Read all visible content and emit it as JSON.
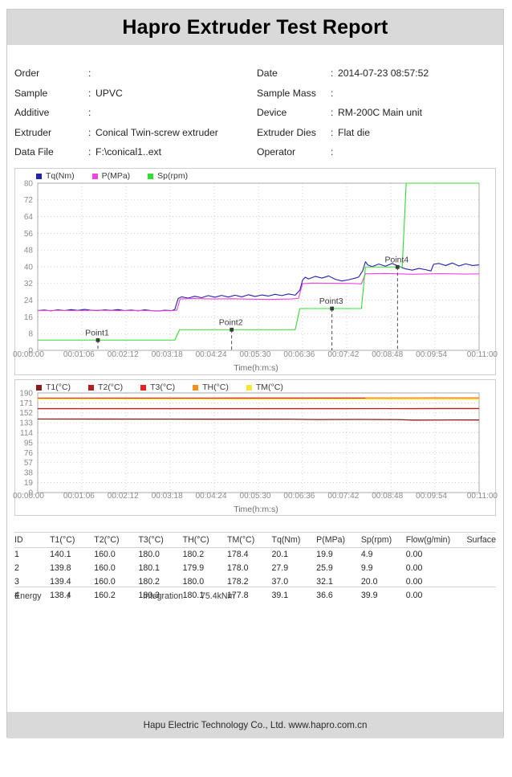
{
  "report": {
    "title": "Hapro Extruder Test Report",
    "footer": "Hapu Electric Technology Co., Ltd. www.hapro.com.cn"
  },
  "meta": {
    "colon": ":",
    "rows": [
      {
        "left_label": "Order",
        "left_value": "",
        "right_label": "Date",
        "right_value": "2014-07-23  08:57:52"
      },
      {
        "left_label": "Sample",
        "left_value": "UPVC",
        "right_label": "Sample Mass",
        "right_value": ""
      },
      {
        "left_label": "Additive",
        "left_value": "",
        "right_label": "Device",
        "right_value": "RM-200C Main unit"
      },
      {
        "left_label": "Extruder",
        "left_value": "Conical Twin-screw extruder",
        "right_label": "Extruder Dies",
        "right_value": "Flat die"
      },
      {
        "left_label": "Data File",
        "left_value": "F:\\conical1..ext",
        "right_label": "Operator",
        "right_value": ""
      }
    ]
  },
  "chart_data": [
    {
      "id": "torque-pressure-speed",
      "type": "line",
      "title": "",
      "xlabel": "Time(h:m:s)",
      "ylabel": "",
      "ylim": [
        0,
        80
      ],
      "yticks": [
        0,
        8,
        16,
        24,
        32,
        40,
        48,
        56,
        64,
        72,
        80
      ],
      "xlim": [
        0,
        660
      ],
      "xticks": [
        "00:00:00",
        "00:01:06",
        "00:02:12",
        "00:03:18",
        "00:04:24",
        "00:05:30",
        "00:06:36",
        "00:07:42",
        "00:08:48",
        "00:09:54",
        "00:11:00"
      ],
      "grid": true,
      "legend_position": "top-left",
      "series": [
        {
          "name": "Tq(Nm)",
          "color": "#2222aa",
          "points": [
            [
              0,
              19.0
            ],
            [
              10,
              19.3
            ],
            [
              20,
              18.9
            ],
            [
              30,
              19.4
            ],
            [
              40,
              19.0
            ],
            [
              50,
              19.5
            ],
            [
              60,
              19.1
            ],
            [
              70,
              19.6
            ],
            [
              80,
              19.2
            ],
            [
              90,
              19.0
            ],
            [
              100,
              19.4
            ],
            [
              110,
              19.1
            ],
            [
              120,
              19.5
            ],
            [
              130,
              19.0
            ],
            [
              140,
              19.3
            ],
            [
              150,
              18.9
            ],
            [
              160,
              19.4
            ],
            [
              170,
              19.0
            ],
            [
              180,
              18.8
            ],
            [
              190,
              19.2
            ],
            [
              200,
              19.0
            ],
            [
              205,
              19.6
            ],
            [
              210,
              24.8
            ],
            [
              215,
              25.6
            ],
            [
              225,
              25.0
            ],
            [
              235,
              25.9
            ],
            [
              245,
              25.2
            ],
            [
              255,
              26.2
            ],
            [
              265,
              25.4
            ],
            [
              275,
              26.3
            ],
            [
              285,
              25.5
            ],
            [
              295,
              26.4
            ],
            [
              305,
              25.6
            ],
            [
              315,
              26.6
            ],
            [
              325,
              25.8
            ],
            [
              335,
              26.5
            ],
            [
              345,
              26.0
            ],
            [
              355,
              26.8
            ],
            [
              365,
              26.2
            ],
            [
              375,
              27.0
            ],
            [
              385,
              26.4
            ],
            [
              392,
              28.8
            ],
            [
              396,
              33.6
            ],
            [
              400,
              35.0
            ],
            [
              405,
              34.2
            ],
            [
              415,
              35.4
            ],
            [
              425,
              34.6
            ],
            [
              435,
              35.6
            ],
            [
              445,
              34.0
            ],
            [
              455,
              33.2
            ],
            [
              465,
              33.8
            ],
            [
              475,
              34.6
            ],
            [
              480,
              35.1
            ],
            [
              486,
              38.1
            ],
            [
              490,
              42.4
            ],
            [
              494,
              40.8
            ],
            [
              500,
              40.1
            ],
            [
              510,
              41.3
            ],
            [
              520,
              40.3
            ],
            [
              530,
              41.6
            ],
            [
              540,
              40.2
            ],
            [
              550,
              39.0
            ],
            [
              560,
              38.4
            ],
            [
              570,
              39.2
            ],
            [
              580,
              38.6
            ],
            [
              588,
              38.0
            ],
            [
              592,
              41.2
            ],
            [
              600,
              41.6
            ],
            [
              610,
              40.6
            ],
            [
              620,
              41.8
            ],
            [
              630,
              40.4
            ],
            [
              640,
              41.4
            ],
            [
              650,
              40.6
            ],
            [
              660,
              40.9
            ]
          ]
        },
        {
          "name": "P(MPa)",
          "color": "#ee44dd",
          "points": [
            [
              0,
              19.0
            ],
            [
              30,
              19.1
            ],
            [
              60,
              19.0
            ],
            [
              90,
              19.2
            ],
            [
              120,
              19.0
            ],
            [
              150,
              19.1
            ],
            [
              180,
              18.9
            ],
            [
              200,
              19.0
            ],
            [
              208,
              19.2
            ],
            [
              213,
              24.6
            ],
            [
              230,
              24.8
            ],
            [
              260,
              24.6
            ],
            [
              290,
              24.7
            ],
            [
              320,
              24.5
            ],
            [
              350,
              24.4
            ],
            [
              380,
              24.6
            ],
            [
              390,
              24.9
            ],
            [
              396,
              31.9
            ],
            [
              410,
              32.2
            ],
            [
              440,
              32.1
            ],
            [
              470,
              32.0
            ],
            [
              484,
              31.8
            ],
            [
              490,
              36.6
            ],
            [
              520,
              36.8
            ],
            [
              560,
              36.4
            ],
            [
              600,
              36.7
            ],
            [
              640,
              36.5
            ],
            [
              660,
              36.6
            ]
          ]
        },
        {
          "name": "Sp(rpm)",
          "color": "#2ee02e",
          "points": [
            [
              0,
              4.9
            ],
            [
              205,
              4.9
            ],
            [
              212,
              9.9
            ],
            [
              385,
              9.9
            ],
            [
              392,
              20.0
            ],
            [
              484,
              20.0
            ],
            [
              490,
              39.9
            ],
            [
              545,
              39.9
            ],
            [
              551,
              80.0
            ],
            [
              660,
              80.0
            ]
          ]
        }
      ],
      "annotations": [
        {
          "label": "Point1",
          "x": 90,
          "y": 4.9,
          "series": "Sp(rpm)"
        },
        {
          "label": "Point2",
          "x": 290,
          "y": 9.9,
          "series": "Sp(rpm)"
        },
        {
          "label": "Point3",
          "x": 440,
          "y": 20.0,
          "series": "Sp(rpm)"
        },
        {
          "label": "Point4",
          "x": 538,
          "y": 39.9,
          "series": "Sp(rpm)"
        }
      ]
    },
    {
      "id": "temperatures",
      "type": "line",
      "title": "",
      "xlabel": "Time(h:m:s)",
      "ylabel": "",
      "ylim": [
        0,
        190
      ],
      "yticks": [
        0,
        19,
        38,
        57,
        76,
        95,
        114,
        133,
        152,
        171,
        190
      ],
      "xlim": [
        0,
        660
      ],
      "xticks": [
        "00:00:00",
        "00:01:06",
        "00:02:12",
        "00:03:18",
        "00:04:24",
        "00:05:30",
        "00:06:36",
        "00:07:42",
        "00:08:48",
        "00:09:54",
        "00:11:00"
      ],
      "grid": true,
      "legend_position": "top-left",
      "series": [
        {
          "name": "T1(°C)",
          "color": "#8b1a1a",
          "points": [
            [
              0,
              140.2
            ],
            [
              100,
              140.1
            ],
            [
              200,
              140.0
            ],
            [
              300,
              139.9
            ],
            [
              380,
              139.8
            ],
            [
              420,
              139.2
            ],
            [
              480,
              139.4
            ],
            [
              540,
              139.0
            ],
            [
              560,
              138.2
            ],
            [
              600,
              138.3
            ],
            [
              620,
              138.5
            ],
            [
              660,
              138.4
            ]
          ]
        },
        {
          "name": "T2(°C)",
          "color": "#b02020",
          "points": [
            [
              0,
              160.0
            ],
            [
              150,
              160.0
            ],
            [
              300,
              160.0
            ],
            [
              450,
              160.0
            ],
            [
              520,
              160.1
            ],
            [
              560,
              160.0
            ],
            [
              600,
              160.2
            ],
            [
              660,
              160.2
            ]
          ]
        },
        {
          "name": "T3(°C)",
          "color": "#e52222",
          "points": [
            [
              0,
              180.0
            ],
            [
              150,
              180.0
            ],
            [
              300,
              180.1
            ],
            [
              450,
              180.2
            ],
            [
              600,
              180.3
            ],
            [
              660,
              180.3
            ]
          ]
        },
        {
          "name": "TH(°C)",
          "color": "#f29020",
          "points": [
            [
              490,
              180.2
            ],
            [
              530,
              180.1
            ],
            [
              580,
              180.0
            ],
            [
              620,
              180.1
            ],
            [
              660,
              180.1
            ]
          ]
        },
        {
          "name": "TM(°C)",
          "color": "#f5e63c",
          "points": [
            [
              0,
              178.4
            ],
            [
              150,
              178.2
            ],
            [
              300,
              178.0
            ],
            [
              450,
              178.2
            ],
            [
              600,
              177.9
            ],
            [
              660,
              177.8
            ]
          ]
        }
      ]
    }
  ],
  "table": {
    "headers": [
      "ID",
      "T1(°C)",
      "T2(°C)",
      "T3(°C)",
      "TH(°C)",
      "TM(°C)",
      "Tq(Nm)",
      "P(MPa)",
      "Sp(rpm)",
      "Flow(g/min)",
      "Surface"
    ],
    "rows": [
      [
        "1",
        "140.1",
        "160.0",
        "180.0",
        "180.2",
        "178.4",
        "20.1",
        "19.9",
        "4.9",
        "0.00",
        ""
      ],
      [
        "2",
        "139.8",
        "160.0",
        "180.1",
        "179.9",
        "178.0",
        "27.9",
        "25.9",
        "9.9",
        "0.00",
        ""
      ],
      [
        "3",
        "139.4",
        "160.0",
        "180.2",
        "180.0",
        "178.2",
        "37.0",
        "32.1",
        "20.0",
        "0.00",
        ""
      ],
      [
        "4",
        "138.4",
        "160.2",
        "180.3",
        "180.1",
        "177.8",
        "39.1",
        "36.6",
        "39.9",
        "0.00",
        ""
      ]
    ]
  },
  "summary": {
    "energy_label": "Energy",
    "energy_value": "/",
    "integration_label": "Integration",
    "integration_value": "75.4kNm"
  }
}
